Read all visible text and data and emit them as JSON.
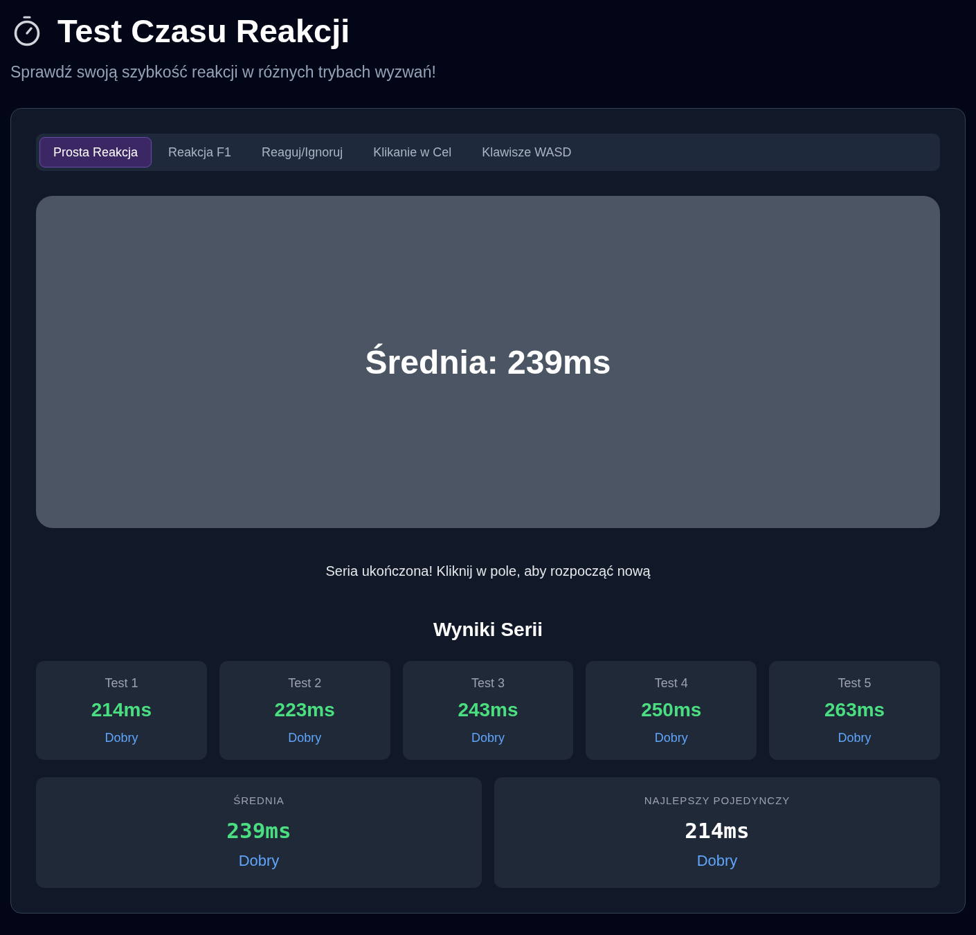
{
  "header": {
    "title": "Test Czasu Reakcji",
    "subtitle": "Sprawdź swoją szybkość reakcji w różnych trybach wyzwań!"
  },
  "tabs": [
    {
      "label": "Prosta Reakcja",
      "selected": true
    },
    {
      "label": "Reakcja F1",
      "selected": false
    },
    {
      "label": "Reaguj/Ignoruj",
      "selected": false
    },
    {
      "label": "Klikanie w Cel",
      "selected": false
    },
    {
      "label": "Klawisze WASD",
      "selected": false
    }
  ],
  "game_area": {
    "message": "Średnia: 239ms"
  },
  "status": "Seria ukończona! Kliknij w pole, aby rozpocząć nową",
  "results": {
    "title": "Wyniki Serii",
    "tests": [
      {
        "label": "Test 1",
        "time": "214ms",
        "rating": "Dobry"
      },
      {
        "label": "Test 2",
        "time": "223ms",
        "rating": "Dobry"
      },
      {
        "label": "Test 3",
        "time": "243ms",
        "rating": "Dobry"
      },
      {
        "label": "Test 4",
        "time": "250ms",
        "rating": "Dobry"
      },
      {
        "label": "Test 5",
        "time": "263ms",
        "rating": "Dobry"
      }
    ]
  },
  "summary": [
    {
      "label": "ŚREDNIA",
      "value": "239ms",
      "rating": "Dobry",
      "color": "#4ade80"
    },
    {
      "label": "NAJLEPSZY POJEDYNCZY",
      "value": "214ms",
      "rating": "Dobry",
      "color": "#ffffff"
    }
  ]
}
